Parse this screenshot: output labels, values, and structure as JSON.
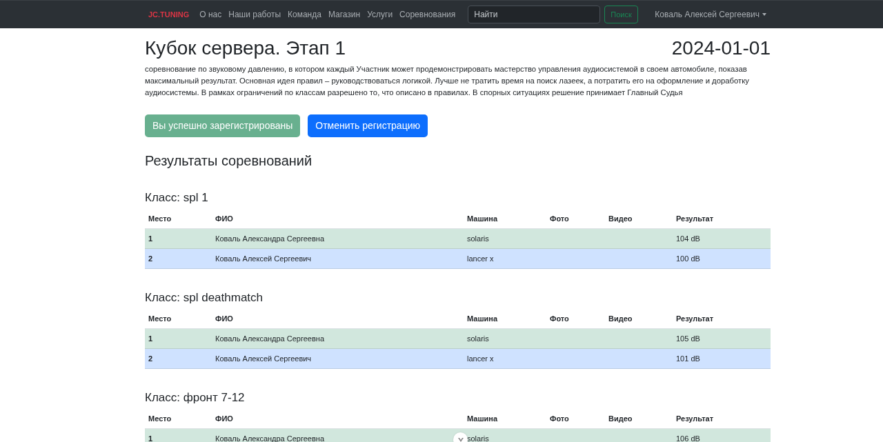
{
  "navbar": {
    "brand": "JC.TUNING",
    "links": [
      {
        "label": "О нас"
      },
      {
        "label": "Наши работы"
      },
      {
        "label": "Команда"
      },
      {
        "label": "Магазин"
      },
      {
        "label": "Услуги"
      },
      {
        "label": "Соревнования"
      }
    ],
    "search": {
      "placeholder": "Найти",
      "button": "Поиск"
    },
    "user": "Коваль Алексей Сергеевич"
  },
  "event": {
    "title": "Кубок сервера. Этап 1",
    "date": "2024-01-01",
    "description": "соревнование по звуковому давлению, в котором каждый Участник может продемонстрировать мастерство управления аудиосистемой в своем автомобиле, показав максимальный результат. Основная идея правил – руководствоваться логикой. Лучше не тратить время на поиск лазеек, а потратить его на оформление и доработку аудиосистемы. В рамках ограничений по классам разрешено то, что описано в правилах. В спорных ситуациях решение принимает Главный Судья"
  },
  "registration": {
    "status": {
      "label": "Вы успешно зарегистрированы",
      "disabled": true
    },
    "cancel": "Отменить регистрацию"
  },
  "results": {
    "heading": "Результаты соревнований",
    "classes": [
      {
        "title": "Класс: spl 1",
        "columns": [
          "Место",
          "ФИО",
          "Машина",
          "Фото",
          "Видео",
          "Результат"
        ],
        "rows": [
          {
            "place": "1",
            "name": "Коваль Александра Сергеевна",
            "car": "solaris",
            "result": "104 dB",
            "color": "#d1e7dd"
          },
          {
            "place": "2",
            "name": "Коваль Алексей Сергеевич",
            "car": "lancer x",
            "result": "100 dB",
            "color": "#cfe2ff"
          }
        ]
      },
      {
        "title": "Класс: spl deathmatch",
        "columns": [
          "Место",
          "ФИО",
          "Машина",
          "Фото",
          "Видео",
          "Результат"
        ],
        "rows": [
          {
            "place": "1",
            "name": "Коваль Александра Сергеевна",
            "car": "solaris",
            "result": "105 dB",
            "color": "#d1e7dd"
          },
          {
            "place": "2",
            "name": "Коваль Алексей Сергеевич",
            "car": "lancer x",
            "result": "101 dB",
            "color": "#cfe2ff"
          }
        ]
      },
      {
        "title": "Класс: фронт 7-12",
        "columns": [
          "Место",
          "ФИО",
          "Машина",
          "Фото",
          "Видео",
          "Результат"
        ],
        "rows": [
          {
            "place": "1",
            "name": "Коваль Александра Сергеевна",
            "car": "solaris",
            "result": "106 dB",
            "color": "#d1e7dd"
          }
        ]
      }
    ]
  }
}
